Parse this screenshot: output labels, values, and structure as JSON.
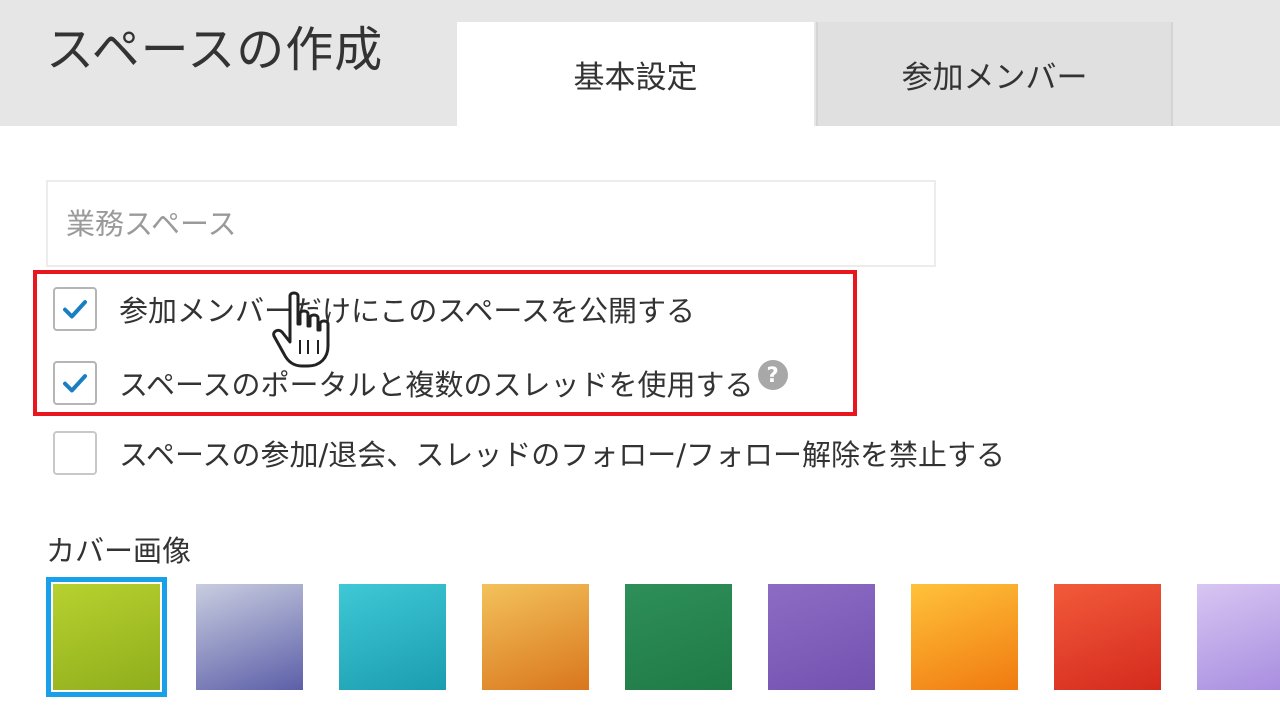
{
  "header": {
    "title": "スペースの作成",
    "tabs": [
      {
        "label": "基本設定",
        "active": true
      },
      {
        "label": "参加メンバー",
        "active": false
      }
    ]
  },
  "form": {
    "space_name": {
      "value": "",
      "placeholder": "業務スペース"
    },
    "options": [
      {
        "label": "参加メンバーだけにこのスペースを公開する",
        "checked": true
      },
      {
        "label": "スペースのポータルと複数のスレッドを使用する",
        "checked": true,
        "help_icon": "question-icon"
      },
      {
        "label": "スペースの参加/退会、スレッドのフォロー/フォロー解除を禁止する",
        "checked": false
      }
    ],
    "cover_image": {
      "label": "カバー画像",
      "selected_index": 0,
      "swatches": [
        {
          "name": "lime-green-texture",
          "colors": [
            "#b7d12f",
            "#8fae1c"
          ]
        },
        {
          "name": "lavender-gradient",
          "colors": [
            "#c9cde0",
            "#5c5fa8"
          ]
        },
        {
          "name": "turquoise-water",
          "colors": [
            "#3fc8d6",
            "#1a9db0"
          ]
        },
        {
          "name": "orange-floral",
          "colors": [
            "#f3c25a",
            "#d9761e"
          ]
        },
        {
          "name": "green-texture",
          "colors": [
            "#2e8f59",
            "#1f7a46"
          ]
        },
        {
          "name": "purple-texture",
          "colors": [
            "#8c6cc4",
            "#7352b0"
          ]
        },
        {
          "name": "orange-lily",
          "colors": [
            "#ffc23a",
            "#f07a10"
          ]
        },
        {
          "name": "red-carnation",
          "colors": [
            "#f25a3a",
            "#d42a1e"
          ]
        },
        {
          "name": "lilac-flowers",
          "colors": [
            "#d8c6f2",
            "#a98ee0"
          ]
        }
      ]
    }
  },
  "colors": {
    "check": "#1a7fc2",
    "highlight": "#e8161f",
    "selection": "#1aa0e8"
  }
}
